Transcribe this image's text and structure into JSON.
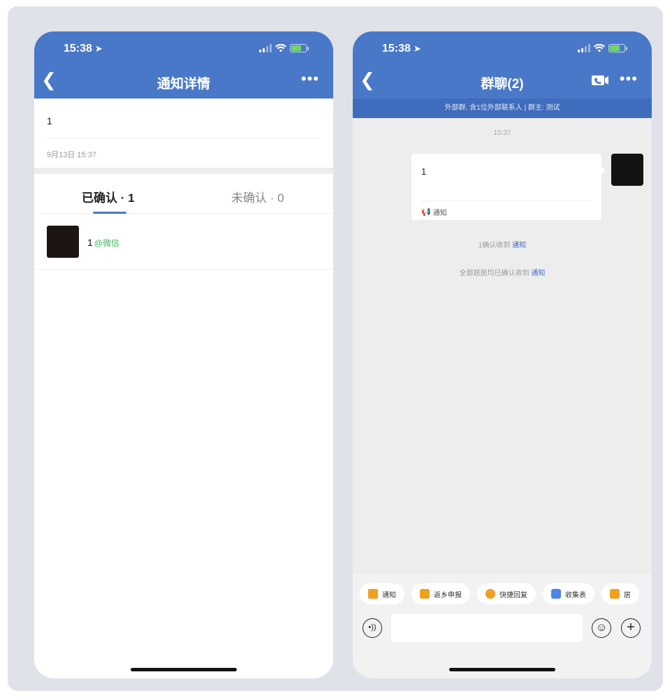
{
  "left": {
    "status_time": "15:38",
    "nav_title": "通知详情",
    "notice_text": "1",
    "notice_date": "9月13日 15:37",
    "tab_confirmed": "已确认 · 1",
    "tab_unconfirmed": "未确认 · 0",
    "member_name": "1",
    "member_tag": "@微信"
  },
  "right": {
    "status_time": "15:38",
    "nav_title": "群聊(2)",
    "subtitle": "外部群, 含1位外部联系人 | 群主: 测试",
    "chat_time": "15:37",
    "bubble_text": "1",
    "bubble_footer": "通知",
    "sys_msg1_text": "1确认收到",
    "sys_msg1_link": "通知",
    "sys_msg2_text": "全部居民均已确认收到",
    "sys_msg2_link": "通知",
    "chips": [
      {
        "label": "通知",
        "icon": "megaphone-icon",
        "color": "#f0a020"
      },
      {
        "label": "返乡申报",
        "icon": "doc-icon",
        "color": "#f0a020"
      },
      {
        "label": "快捷回复",
        "icon": "reply-icon",
        "color": "#f0a020"
      },
      {
        "label": "收集表",
        "icon": "form-icon",
        "color": "#4a86e8"
      },
      {
        "label": "居",
        "icon": "calendar-icon",
        "color": "#f0a020"
      }
    ]
  },
  "colors": {
    "brand_blue": "#4a78c8",
    "accent_green": "#3db55a"
  }
}
